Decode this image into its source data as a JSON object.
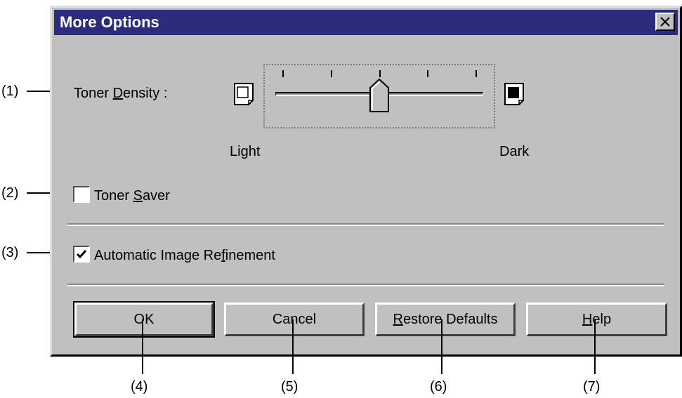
{
  "dialog": {
    "title": "More Options",
    "close_glyph": "X"
  },
  "toner_density": {
    "label_prefix": "Toner ",
    "label_mnemonic": "D",
    "label_suffix": "ensity :",
    "light_label": "Light",
    "dark_label": "Dark",
    "slider_level": 0.5,
    "tick_count": 5
  },
  "toner_saver": {
    "label_prefix": "Toner ",
    "label_mnemonic": "S",
    "label_suffix": "aver",
    "checked": false
  },
  "auto_refine": {
    "label_prefix": "Automatic Image Re",
    "label_mnemonic": "f",
    "label_suffix": "inement",
    "checked": true
  },
  "buttons": {
    "ok": "OK",
    "cancel": "Cancel",
    "restore_mnemonic": "R",
    "restore_rest": "estore Defaults",
    "help_mnemonic": "H",
    "help_rest": "elp"
  },
  "callouts": [
    "(1)",
    "(2)",
    "(3)",
    "(4)",
    "(5)",
    "(6)",
    "(7)"
  ],
  "colors": {
    "titlebar": "#2c2c7e",
    "face": "#c0c0c0"
  }
}
